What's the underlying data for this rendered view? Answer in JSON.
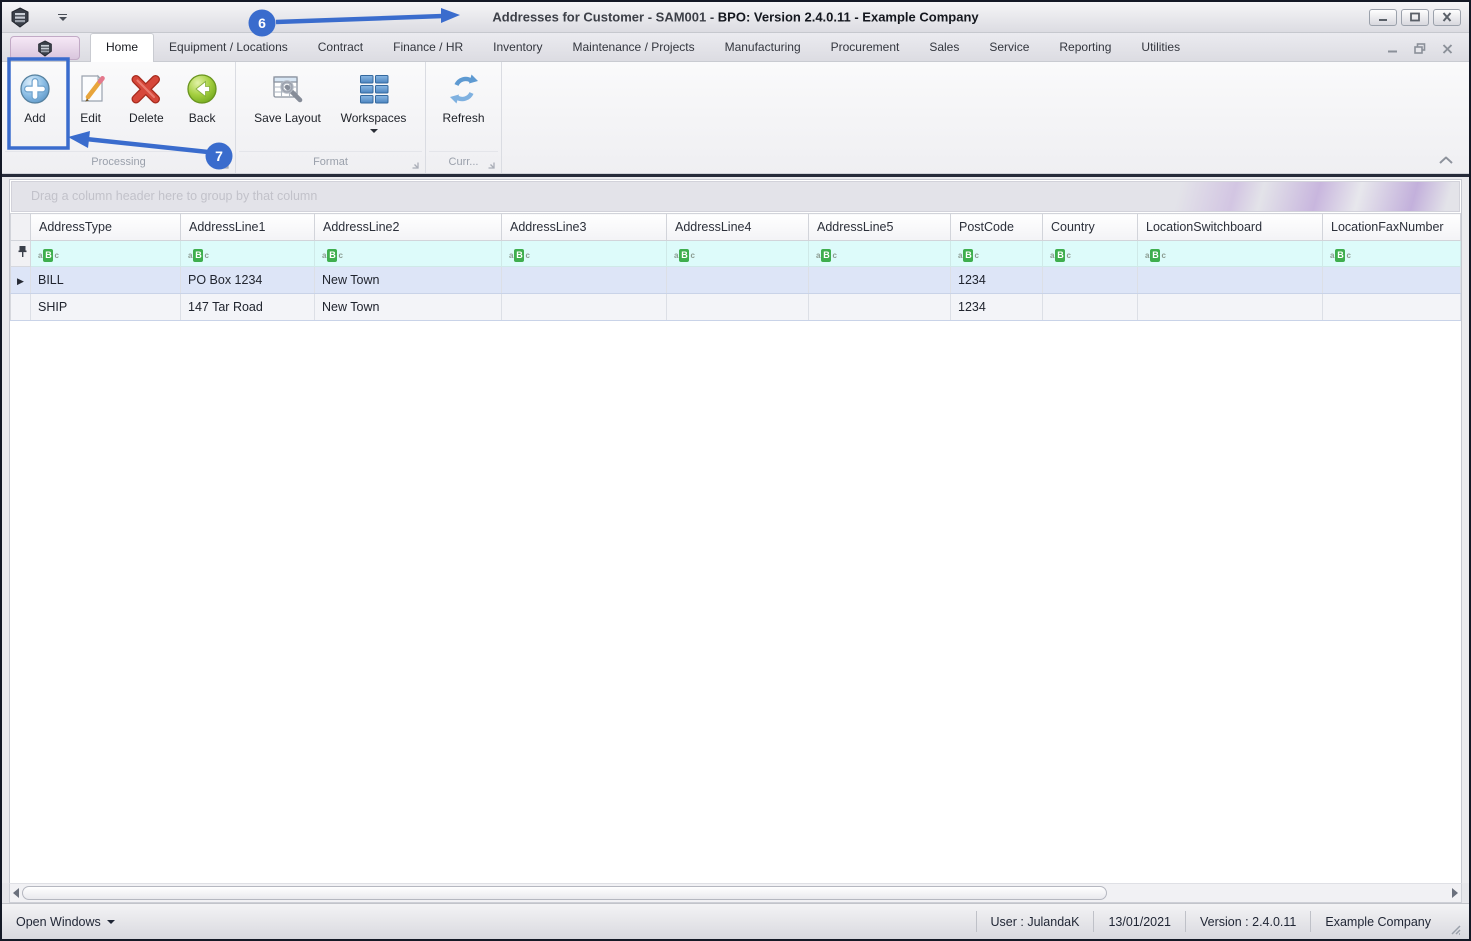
{
  "window": {
    "title_primary": "Addresses for Customer - SAM001 - ",
    "title_secondary": "BPO: Version 2.4.0.11 - Example Company"
  },
  "tabs": [
    "Home",
    "Equipment / Locations",
    "Contract",
    "Finance / HR",
    "Inventory",
    "Maintenance / Projects",
    "Manufacturing",
    "Procurement",
    "Sales",
    "Service",
    "Reporting",
    "Utilities"
  ],
  "ribbon": {
    "groups": [
      {
        "caption": "Processing",
        "buttons": [
          {
            "label": "Add"
          },
          {
            "label": "Edit"
          },
          {
            "label": "Delete"
          },
          {
            "label": "Back"
          }
        ]
      },
      {
        "caption": "Format",
        "buttons": [
          {
            "label": "Save Layout"
          },
          {
            "label": "Workspaces"
          }
        ]
      },
      {
        "caption": "Curr...",
        "buttons": [
          {
            "label": "Refresh"
          }
        ]
      }
    ]
  },
  "callouts": {
    "six": "6",
    "seven": "7"
  },
  "grid": {
    "group_by_hint": "Drag a column header here to group by that column",
    "columns": [
      "AddressType",
      "AddressLine1",
      "AddressLine2",
      "AddressLine3",
      "AddressLine4",
      "AddressLine5",
      "PostCode",
      "Country",
      "LocationSwitchboard",
      "LocationFaxNumber"
    ],
    "filter_icon": {
      "a": "a",
      "b": "B",
      "c": "c"
    },
    "rows": [
      {
        "selected": true,
        "cells": [
          "BILL",
          "PO Box 1234",
          "New Town",
          "",
          "",
          "",
          "1234",
          "",
          "",
          ""
        ]
      },
      {
        "selected": false,
        "cells": [
          "SHIP",
          "147 Tar Road",
          "New Town",
          "",
          "",
          "",
          "1234",
          "",
          "",
          ""
        ]
      }
    ]
  },
  "statusbar": {
    "open_windows": "Open Windows",
    "user": "User : JulandaK",
    "date": "13/01/2021",
    "version": "Version : 2.4.0.11",
    "company": "Example Company"
  },
  "colors": {
    "accent_blue": "#3a6ccd",
    "filter_green": "#3fae4e",
    "selected_row": "#dde5f7",
    "filter_row": "#ddfbfa"
  }
}
